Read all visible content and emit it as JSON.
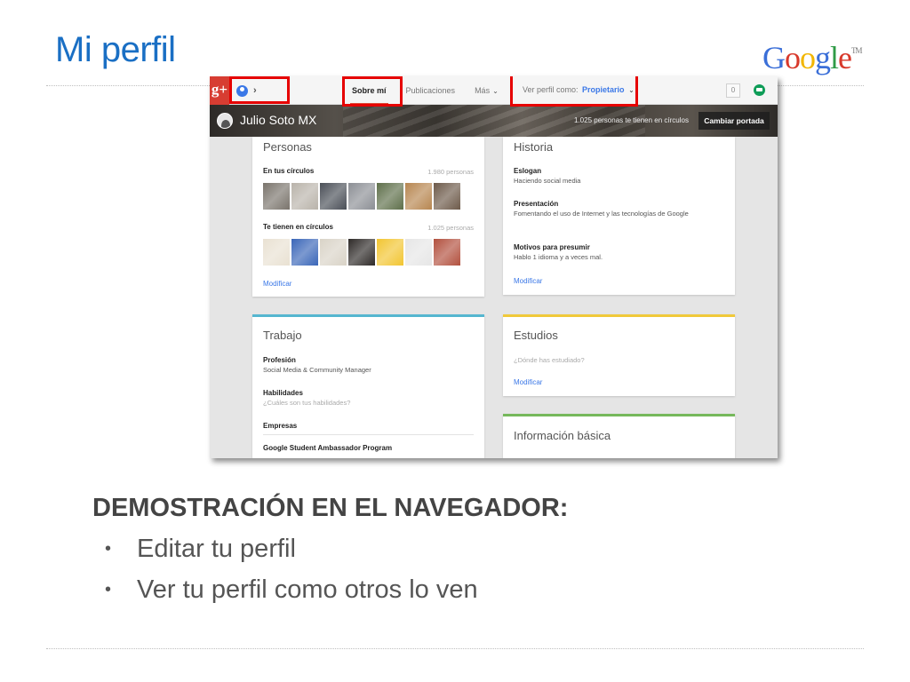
{
  "slide": {
    "title": "Mi perfil",
    "logo_letters": [
      {
        "ch": "G",
        "color": "#3b6fd8"
      },
      {
        "ch": "o",
        "color": "#d8392b"
      },
      {
        "ch": "o",
        "color": "#f2b600"
      },
      {
        "ch": "g",
        "color": "#3b6fd8"
      },
      {
        "ch": "l",
        "color": "#2f9b46"
      },
      {
        "ch": "e",
        "color": "#d8392b"
      }
    ],
    "logo_tm": "TM",
    "heading": "DEMOSTRACIÓN EN EL NAVEGADOR:",
    "bullet_glyph": "•",
    "bullets": [
      "Editar tu perfil",
      "Ver tu perfil como otros lo ven"
    ]
  },
  "gplus": {
    "logo": "g+",
    "profile_chevron": "›",
    "tabs": [
      {
        "label": "Sobre mí",
        "active": true
      },
      {
        "label": "Publicaciones",
        "active": false
      },
      {
        "label": "Más",
        "active": false
      }
    ],
    "tab_caret": "⌄",
    "view_as_label": "Ver perfil como:",
    "view_as_value": "Propietario",
    "view_as_caret": "⌄",
    "notification_count": "0",
    "cover": {
      "name": "Julio Soto MX",
      "circled_text": "1.025 personas te tienen en círculos",
      "button": "Cambiar portada"
    },
    "personas": {
      "title": "Personas",
      "in_circles_label": "En tus círculos",
      "in_circles_count": "1.980 personas",
      "have_you_label": "Te tienen en círculos",
      "have_you_count": "1.025 personas",
      "modify": "Modificar",
      "photo_colors_1": [
        "#7a746c",
        "#b9b3aa",
        "#4a4f57",
        "#8c8f95",
        "#5e6f4a",
        "#b78650",
        "#6d5a4a"
      ],
      "photo_colors_2": [
        "#e9e1d2",
        "#3a66b8",
        "#d9d3c7",
        "#2e2a28",
        "#f2c531",
        "#e6e6e6",
        "#b2503e"
      ]
    },
    "historia": {
      "title": "Historia",
      "slogan_label": "Eslogan",
      "slogan_value": "Haciendo social media",
      "intro_label": "Presentación",
      "intro_value": "Fomentando el uso de Internet y las tecnologías de Google",
      "brag_label": "Motivos para presumir",
      "brag_value": "Hablo 1 idioma y a veces mal.",
      "modify": "Modificar"
    },
    "trabajo": {
      "title": "Trabajo",
      "accent": "#55b6d0",
      "profession_label": "Profesión",
      "profession_value": "Social Media & Community Manager",
      "skills_label": "Habilidades",
      "skills_hint": "¿Cuáles son tus habilidades?",
      "companies_label": "Empresas",
      "company_1": "Google Student Ambassador Program"
    },
    "estudios": {
      "title": "Estudios",
      "accent": "#f0c93a",
      "hint": "¿Dónde has estudiado?",
      "modify": "Modificar"
    },
    "info_basica": {
      "title": "Información básica",
      "accent": "#76b85b"
    }
  }
}
